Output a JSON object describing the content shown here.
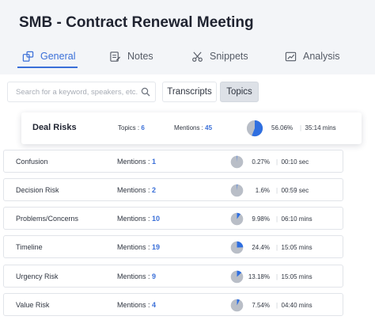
{
  "header": {
    "title": "SMB - Contract Renewal Meeting"
  },
  "tabs": [
    {
      "label": "General",
      "icon": "general-icon",
      "active": true
    },
    {
      "label": "Notes",
      "icon": "notes-icon",
      "active": false
    },
    {
      "label": "Snippets",
      "icon": "snippets-icon",
      "active": false
    },
    {
      "label": "Analysis",
      "icon": "analysis-icon",
      "active": false
    }
  ],
  "search": {
    "placeholder": "Search for a keyword, speakers, etc.",
    "value": ""
  },
  "view_toggle": {
    "transcripts": "Transcripts",
    "topics": "Topics",
    "selected": "Topics"
  },
  "deal_risks": {
    "title": "Deal Risks",
    "topics_label": "Topics : ",
    "topics_count": "6",
    "mentions_label": "Mentions : ",
    "mentions_count": "45",
    "percent": "56.06%",
    "percent_value": 56.06,
    "duration": "35:14 mins"
  },
  "separator": "|",
  "topics": [
    {
      "name": "Confusion",
      "mentions_label": "Mentions : ",
      "mentions": "1",
      "percent": "0.27%",
      "percent_value": 0.27,
      "duration": "00:10 sec"
    },
    {
      "name": "Decision Risk",
      "mentions_label": "Mentions : ",
      "mentions": "2",
      "percent": "1.6%",
      "percent_value": 1.6,
      "duration": "00:59 sec"
    },
    {
      "name": "Problems/Concerns",
      "mentions_label": "Mentions : ",
      "mentions": "10",
      "percent": "9.98%",
      "percent_value": 9.98,
      "duration": "06:10 mins"
    },
    {
      "name": "Timeline",
      "mentions_label": "Mentions : ",
      "mentions": "19",
      "percent": "24.4%",
      "percent_value": 24.4,
      "duration": "15:05 mins"
    },
    {
      "name": "Urgency Risk",
      "mentions_label": "Mentions : ",
      "mentions": "9",
      "percent": "13.18%",
      "percent_value": 13.18,
      "duration": "15:05 mins"
    },
    {
      "name": "Value Risk",
      "mentions_label": "Mentions : ",
      "mentions": "4",
      "percent": "7.54%",
      "percent_value": 7.54,
      "duration": "04:40 mins"
    }
  ],
  "colors": {
    "accent": "#3a6fd8",
    "pie_track": "#b9bec7",
    "pie_fill": "#2f6fe0"
  }
}
